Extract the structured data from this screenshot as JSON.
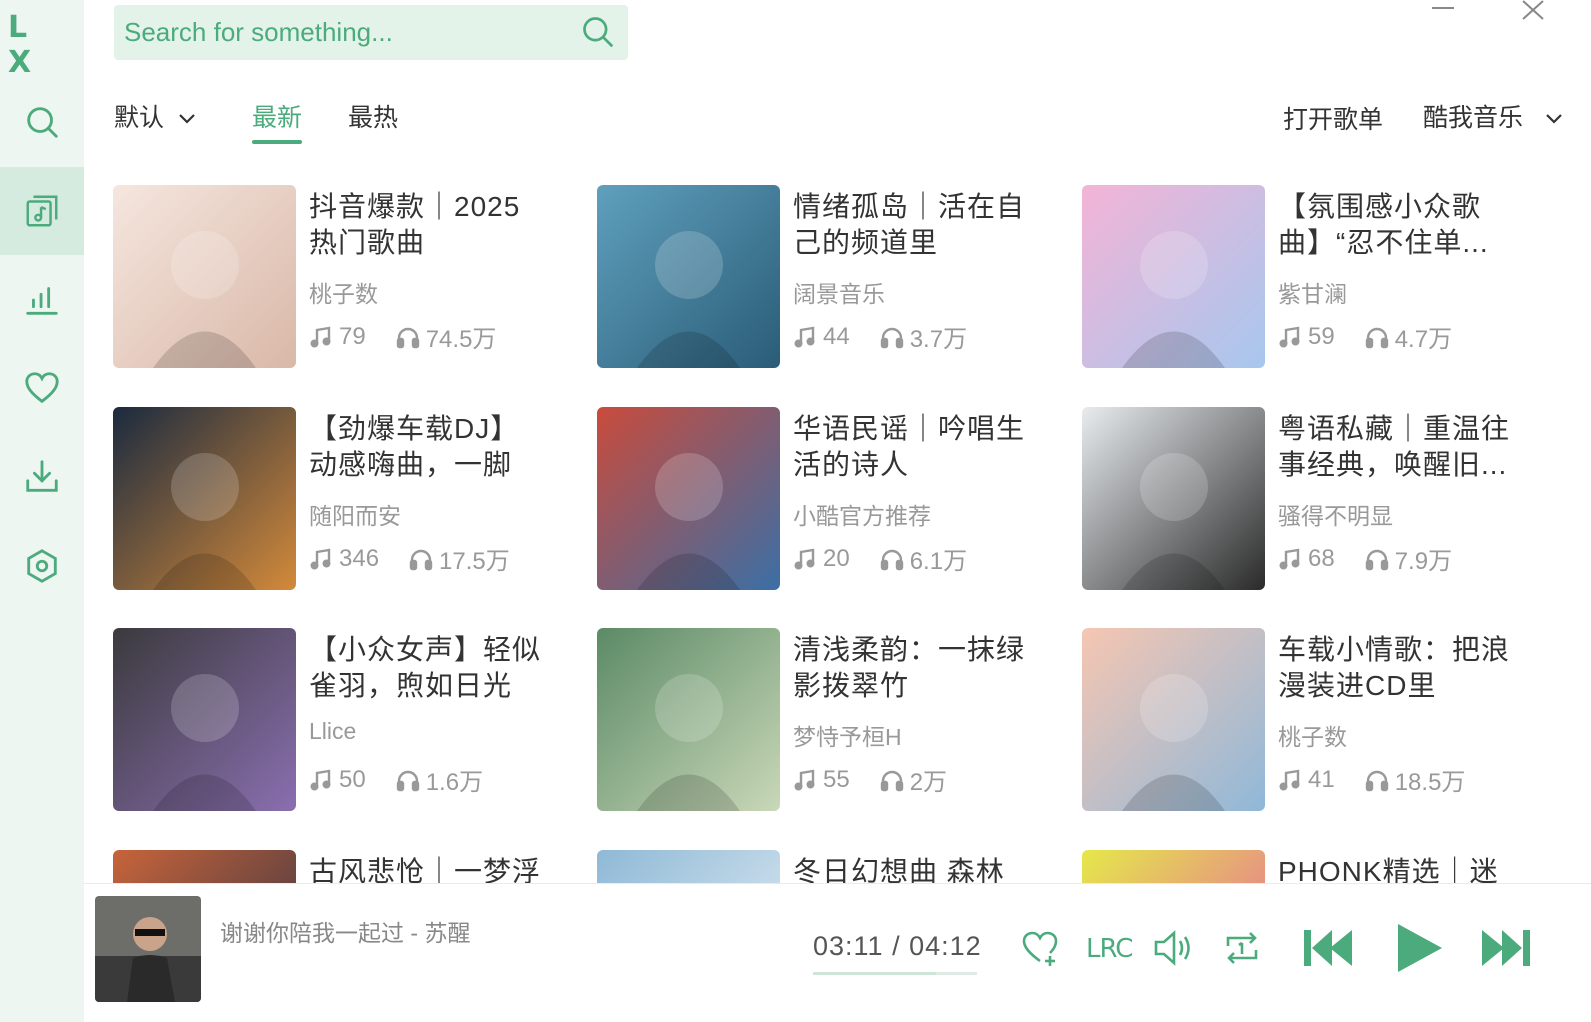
{
  "app": {
    "logo": "L X",
    "accent": "#4cab7c"
  },
  "sidebar": {
    "items": [
      {
        "name": "search",
        "icon": "search-icon",
        "active": false
      },
      {
        "name": "songlist",
        "icon": "music-folder-icon",
        "active": true
      },
      {
        "name": "leaderboard",
        "icon": "chart-bars-icon",
        "active": false
      },
      {
        "name": "favorites",
        "icon": "heart-icon",
        "active": false
      },
      {
        "name": "download",
        "icon": "download-icon",
        "active": false
      },
      {
        "name": "settings",
        "icon": "settings-hexagon-icon",
        "active": false
      }
    ]
  },
  "search": {
    "placeholder": "Search for something..."
  },
  "filters": {
    "sort_label": "默认",
    "tabs": [
      "最新",
      "最热"
    ],
    "active_tab": "最新",
    "open_playlist": "打开歌单",
    "source": "酷我音乐"
  },
  "playlists": [
    {
      "title": "抖音爆款｜2025热门歌曲",
      "author": "桃子数",
      "songs": "79",
      "plays": "74.5万",
      "colors": [
        "#f5e6de",
        "#d9b8a8"
      ]
    },
    {
      "title": "情绪孤岛｜活在自己的频道里",
      "author": "阔景音乐",
      "songs": "44",
      "plays": "3.7万",
      "colors": [
        "#5fa0bd",
        "#2a5c77"
      ]
    },
    {
      "title": "【氛围感小众歌曲】“忍不住单...",
      "author": "紫甘澜",
      "songs": "59",
      "plays": "4.7万",
      "colors": [
        "#f3b4d6",
        "#a7c7ee"
      ]
    },
    {
      "title": "【劲爆车载DJ】动感嗨曲，一脚踩...",
      "author": "随阳而安",
      "songs": "346",
      "plays": "17.5万",
      "colors": [
        "#1a2a3f",
        "#d48a3a"
      ]
    },
    {
      "title": "华语民谣｜吟唱生活的诗人",
      "author": "小酷官方推荐",
      "songs": "20",
      "plays": "6.1万",
      "colors": [
        "#c94b3c",
        "#3a6fa6"
      ]
    },
    {
      "title": "粤语私藏｜重温往事经典，唤醒旧...",
      "author": "骚得不明显",
      "songs": "68",
      "plays": "7.9万",
      "colors": [
        "#e8ecef",
        "#2a2a2a"
      ]
    },
    {
      "title": "【小众女声】轻似雀羽，煦如日光",
      "author": "Llice",
      "songs": "50",
      "plays": "1.6万",
      "colors": [
        "#3b3a3d",
        "#8a6fb0"
      ]
    },
    {
      "title": "清浅柔韵：一抹绿影拨翠竹",
      "author": "梦恃予桓H",
      "songs": "55",
      "plays": "2万",
      "colors": [
        "#5c8a66",
        "#c9d8b8"
      ]
    },
    {
      "title": "车载小情歌：把浪漫装进CD里",
      "author": "桃子数",
      "songs": "41",
      "plays": "18.5万",
      "colors": [
        "#f6c6b2",
        "#8fb8d9"
      ]
    },
    {
      "title": "古风悲怆｜一梦浮",
      "author": "",
      "songs": "",
      "plays": "",
      "colors": [
        "#c7643a",
        "#2b2f44"
      ]
    },
    {
      "title": "冬日幻想曲 森林憧",
      "author": "",
      "songs": "",
      "plays": "",
      "colors": [
        "#8fb9d6",
        "#e9f1f6"
      ]
    },
    {
      "title": "PHONK精选｜迷",
      "author": "",
      "songs": "",
      "plays": "",
      "colors": [
        "#e5e84a",
        "#e65aa8"
      ]
    }
  ],
  "player": {
    "song": "谢谢你陪我一起过 - 苏醒",
    "time": "03:11 / 04:12",
    "progress": 0.75,
    "lrc_label": "LRC",
    "controls": [
      "heart-add-icon",
      "volume-icon",
      "repeat-one-icon",
      "prev-icon",
      "play-icon",
      "next-icon"
    ]
  }
}
